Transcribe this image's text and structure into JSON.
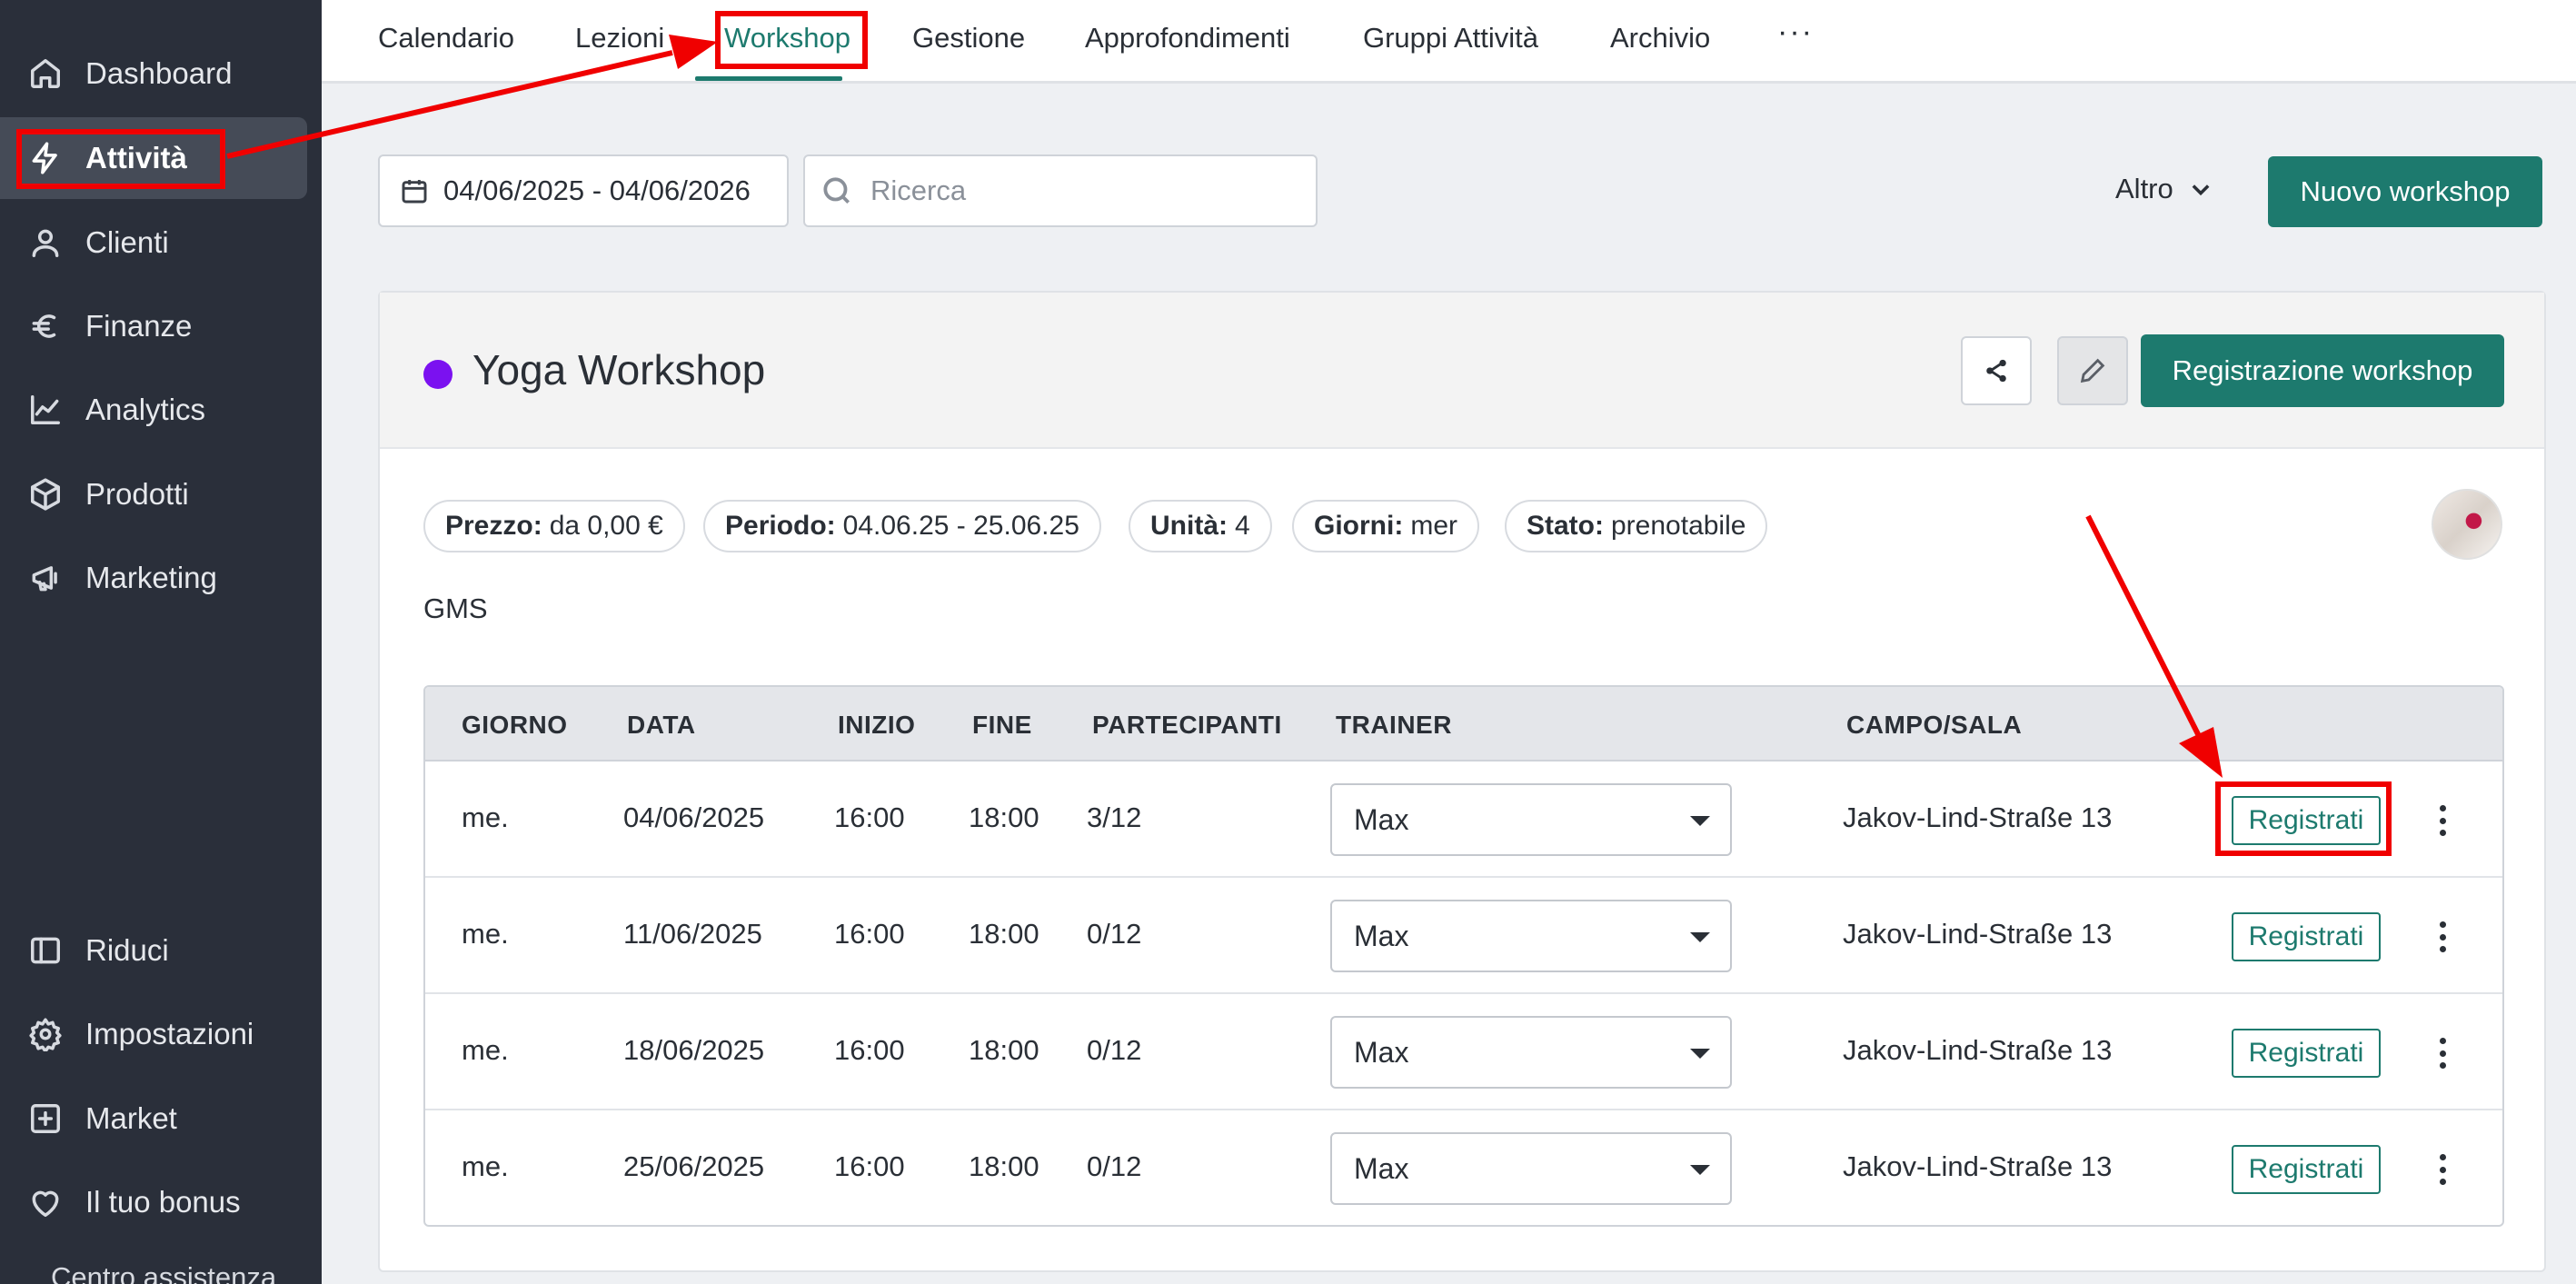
{
  "sidebar": {
    "items": [
      {
        "label": "Dashboard",
        "icon": "home-icon"
      },
      {
        "label": "Attività",
        "icon": "lightning-icon"
      },
      {
        "label": "Clienti",
        "icon": "user-icon"
      },
      {
        "label": "Finanze",
        "icon": "euro-icon"
      },
      {
        "label": "Analytics",
        "icon": "chart-line-icon"
      },
      {
        "label": "Prodotti",
        "icon": "box-icon"
      },
      {
        "label": "Marketing",
        "icon": "megaphone-icon"
      }
    ],
    "bottom_items": [
      {
        "label": "Riduci",
        "icon": "sidebar-collapse-icon"
      },
      {
        "label": "Impostazioni",
        "icon": "gear-icon"
      },
      {
        "label": "Market",
        "icon": "plus-square-icon"
      },
      {
        "label": "Il tuo bonus",
        "icon": "heart-icon"
      }
    ],
    "help_label_cut": "Centro assistenza"
  },
  "tabs": {
    "items": [
      "Calendario",
      "Lezioni",
      "Workshop",
      "Gestione",
      "Approfondimenti",
      "Gruppi Attività",
      "Archivio"
    ],
    "more": "···",
    "active": "Workshop"
  },
  "filters": {
    "date_range": "04/06/2025 - 04/06/2026",
    "search_placeholder": "Ricerca",
    "more_label": "Altro",
    "new_button": "Nuovo workshop"
  },
  "workshop": {
    "title": "Yoga Workshop",
    "color": "#7b11f0",
    "register_button": "Registrazione workshop",
    "meta": [
      {
        "key": "Prezzo:",
        "value": "da 0,00 €"
      },
      {
        "key": "Periodo:",
        "value": "04.06.25 - 25.06.25"
      },
      {
        "key": "Unità:",
        "value": "4"
      },
      {
        "key": "Giorni:",
        "value": "mer"
      },
      {
        "key": "Stato:",
        "value": "prenotabile"
      }
    ],
    "description": "GMS"
  },
  "table": {
    "headers": [
      "GIORNO",
      "DATA",
      "INIZIO",
      "FINE",
      "PARTECIPANTI",
      "TRAINER",
      "CAMPO/SALA"
    ],
    "rows": [
      {
        "day": "me.",
        "date": "04/06/2025",
        "start": "16:00",
        "end": "18:00",
        "participants": "3/12",
        "trainer": "Max",
        "room": "Jakov-Lind-Straße 13",
        "action": "Registrati"
      },
      {
        "day": "me.",
        "date": "11/06/2025",
        "start": "16:00",
        "end": "18:00",
        "participants": "0/12",
        "trainer": "Max",
        "room": "Jakov-Lind-Straße 13",
        "action": "Registrati"
      },
      {
        "day": "me.",
        "date": "18/06/2025",
        "start": "16:00",
        "end": "18:00",
        "participants": "0/12",
        "trainer": "Max",
        "room": "Jakov-Lind-Straße 13",
        "action": "Registrati"
      },
      {
        "day": "me.",
        "date": "25/06/2025",
        "start": "16:00",
        "end": "18:00",
        "participants": "0/12",
        "trainer": "Max",
        "room": "Jakov-Lind-Straße 13",
        "action": "Registrati"
      }
    ]
  },
  "colors": {
    "accent": "#1d7a6e",
    "sidebar_bg": "#2a2f3a",
    "annotation": "#f00000"
  }
}
